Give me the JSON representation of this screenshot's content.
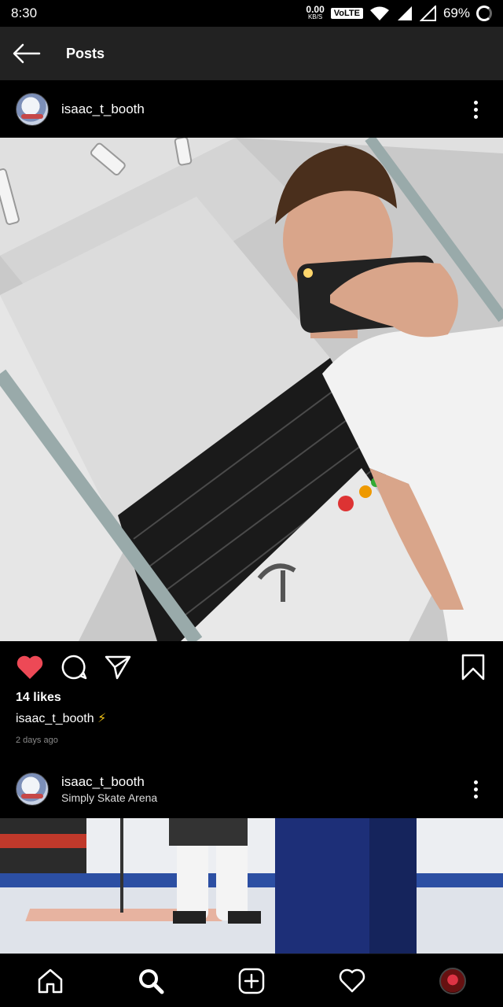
{
  "status_bar": {
    "time": "8:30",
    "speed_value": "0.00",
    "speed_unit": "KB/S",
    "network_label": "VoLTE",
    "battery": "69%"
  },
  "app_bar": {
    "title": "Posts",
    "back_icon": "arrow-left-icon"
  },
  "post1": {
    "username": "isaac_t_booth",
    "likes": "14 likes",
    "caption_user": "isaac_t_booth",
    "caption_emoji": "⚡",
    "time_ago": "2 days ago",
    "liked": true,
    "colors": {
      "like": "#ed4956"
    }
  },
  "post2": {
    "username": "isaac_t_booth",
    "location": "Simply Skate Arena"
  },
  "bottom_nav": {
    "items": [
      "home-icon",
      "search-icon",
      "add-post-icon",
      "activity-heart-icon",
      "profile-avatar"
    ]
  }
}
